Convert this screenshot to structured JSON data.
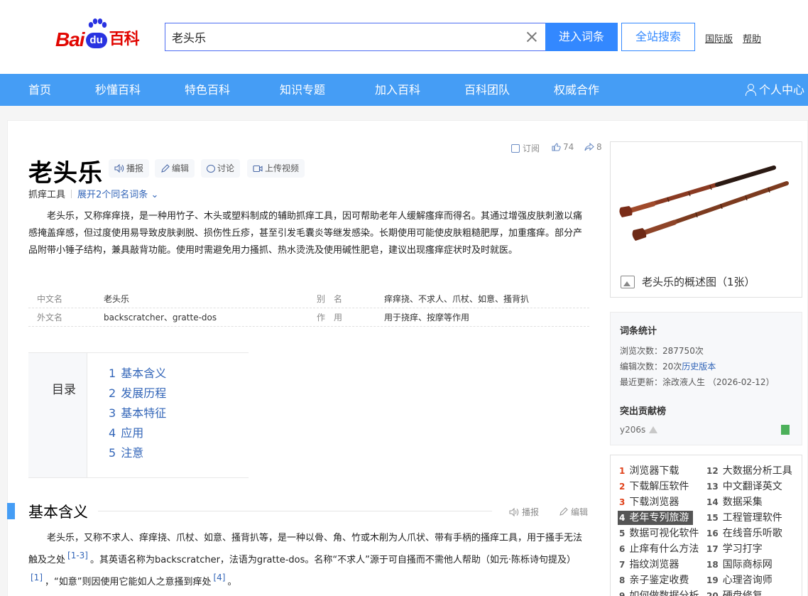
{
  "logo": {
    "bai": "Bai",
    "du": "du",
    "baike": "百科"
  },
  "search": {
    "value": "老头乐",
    "enter_label": "进入词条",
    "site_search_label": "全站搜索"
  },
  "top_links": {
    "international": "国际版",
    "help": "帮助"
  },
  "nav": {
    "items": [
      "首页",
      "秒懂百科",
      "特色百科",
      "知识专题",
      "加入百科",
      "百科团队",
      "权威合作"
    ],
    "user_center": "个人中心"
  },
  "entry": {
    "subscribe": "订阅",
    "likes": "74",
    "shares": "8",
    "title": "老头乐",
    "chips": [
      "播报",
      "编辑",
      "讨论",
      "上传视频"
    ],
    "subtitle": "抓痒工具",
    "expand": "展开2个同名词条",
    "summary": "老头乐，又称痒痒挠，是一种用竹子、木头或塑料制成的辅助抓痒工具，因可帮助老年人缓解瘙痒而得名。其通过增强皮肤刺激以痛感掩盖痒感，但过度使用易导致皮肤剥脱、损伤性丘疹，甚至引发毛囊炎等继发感染。长期使用可能使皮肤粗糙肥厚，加重瘙痒。部分产品附带小锤子结构，兼具敲背功能。使用时需避免用力搔抓、热水烫洗及使用碱性肥皂，建议出现瘙痒症状时及时就医。"
  },
  "info": {
    "rows": [
      {
        "k1": "中文名",
        "v1": "老头乐",
        "k2": "别　名",
        "v2": "痒痒挠、不求人、爪杖、如意、搔背扒"
      },
      {
        "k1": "外文名",
        "v1": "backscratcher、gratte-dos",
        "k2": "作　用",
        "v2": "用于挠痒、按摩等作用"
      }
    ]
  },
  "toc": {
    "title": "目录",
    "items": [
      {
        "num": "1",
        "label": "基本含义"
      },
      {
        "num": "2",
        "label": "发展历程"
      },
      {
        "num": "3",
        "label": "基本特征"
      },
      {
        "num": "4",
        "label": "应用"
      },
      {
        "num": "5",
        "label": "注意"
      }
    ]
  },
  "section": {
    "title": "基本含义",
    "play": "播报",
    "edit": "编辑",
    "p1": "老头乐，又称不求人、痒痒挠、爪杖、如意、搔背扒等，是一种以骨、角、竹或木削为人爪状、带有手柄的搔痒工具，用于搔手无法触及之处",
    "ref1": "[1-3]",
    "p2": "。其英语名称为backscratcher，法语为gratte-dos。名称“不求人”源于可自搔而不需他人帮助（如元·陈栎诗句提及）",
    "ref2": "[1]",
    "p3": "，“如意”则因使用它能如人之意搔到痒处",
    "ref3": "[4]",
    "p4": "。"
  },
  "image": {
    "caption": "老头乐的概述图（1张）"
  },
  "stats": {
    "title": "词条统计",
    "views_label": "浏览次数：",
    "views": "287750次",
    "edits_label": "编辑次数：",
    "edits": "20次",
    "history": "历史版本",
    "updated_label": "最近更新：",
    "updated": "涂改液人生 （2026-02-12）",
    "contrib_title": "突出贡献榜",
    "contributor": "y206s"
  },
  "hot": {
    "left": [
      {
        "n": "1",
        "t": "浏览器下载"
      },
      {
        "n": "2",
        "t": "下载解压软件"
      },
      {
        "n": "3",
        "t": "下载浏览器"
      },
      {
        "n": "4",
        "t": "老年专列旅游"
      },
      {
        "n": "5",
        "t": "数据可视化软件"
      },
      {
        "n": "6",
        "t": "止痒有什么方法"
      },
      {
        "n": "7",
        "t": "指纹浏览器"
      },
      {
        "n": "8",
        "t": "亲子鉴定收费"
      },
      {
        "n": "9",
        "t": "如何做数据分析"
      }
    ],
    "right": [
      {
        "n": "12",
        "t": "大数据分析工具"
      },
      {
        "n": "13",
        "t": "中文翻译英文"
      },
      {
        "n": "14",
        "t": "数据采集"
      },
      {
        "n": "15",
        "t": "工程管理软件"
      },
      {
        "n": "16",
        "t": "在线音乐听歌"
      },
      {
        "n": "17",
        "t": "学习打字"
      },
      {
        "n": "18",
        "t": "国际商标网"
      },
      {
        "n": "19",
        "t": "心理咨询师"
      },
      {
        "n": "20",
        "t": "硬盘修复"
      }
    ]
  }
}
